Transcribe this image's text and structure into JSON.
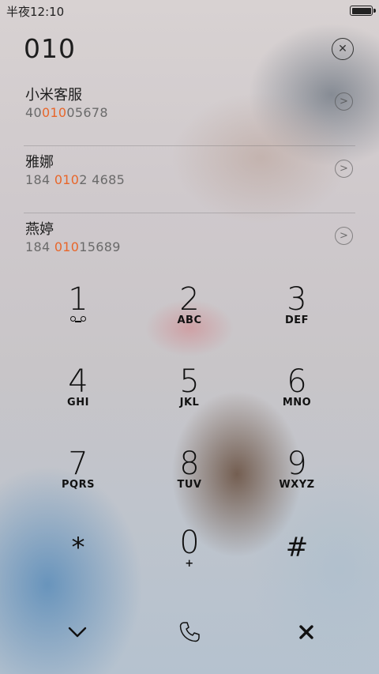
{
  "status_bar": {
    "time": "半夜12:10"
  },
  "dialer": {
    "number": "010"
  },
  "results": [
    {
      "name": "小米客服",
      "number_before": "40",
      "number_match": "010",
      "number_after": "05678"
    },
    {
      "name": "雅娜",
      "number_before": "184 ",
      "number_match": "010",
      "number_after": "2 4685"
    },
    {
      "name": "燕婷",
      "number_before": "184 ",
      "number_match": "010",
      "number_after": "15689"
    }
  ],
  "keypad": [
    {
      "digit": "1",
      "letters": "",
      "voicemail": true
    },
    {
      "digit": "2",
      "letters": "ABC"
    },
    {
      "digit": "3",
      "letters": "DEF"
    },
    {
      "digit": "4",
      "letters": "GHI"
    },
    {
      "digit": "5",
      "letters": "JKL"
    },
    {
      "digit": "6",
      "letters": "MNO"
    },
    {
      "digit": "7",
      "letters": "PQRS"
    },
    {
      "digit": "8",
      "letters": "TUV"
    },
    {
      "digit": "9",
      "letters": "WXYZ"
    },
    {
      "symbol": "*"
    },
    {
      "digit": "0",
      "letters": "+"
    },
    {
      "symbol": "#"
    }
  ],
  "icons": {
    "clear": "close-icon",
    "collapse": "chevron-down-icon",
    "call": "phone-icon",
    "delete": "delete-icon"
  },
  "colors": {
    "highlight": "#e8662a"
  }
}
